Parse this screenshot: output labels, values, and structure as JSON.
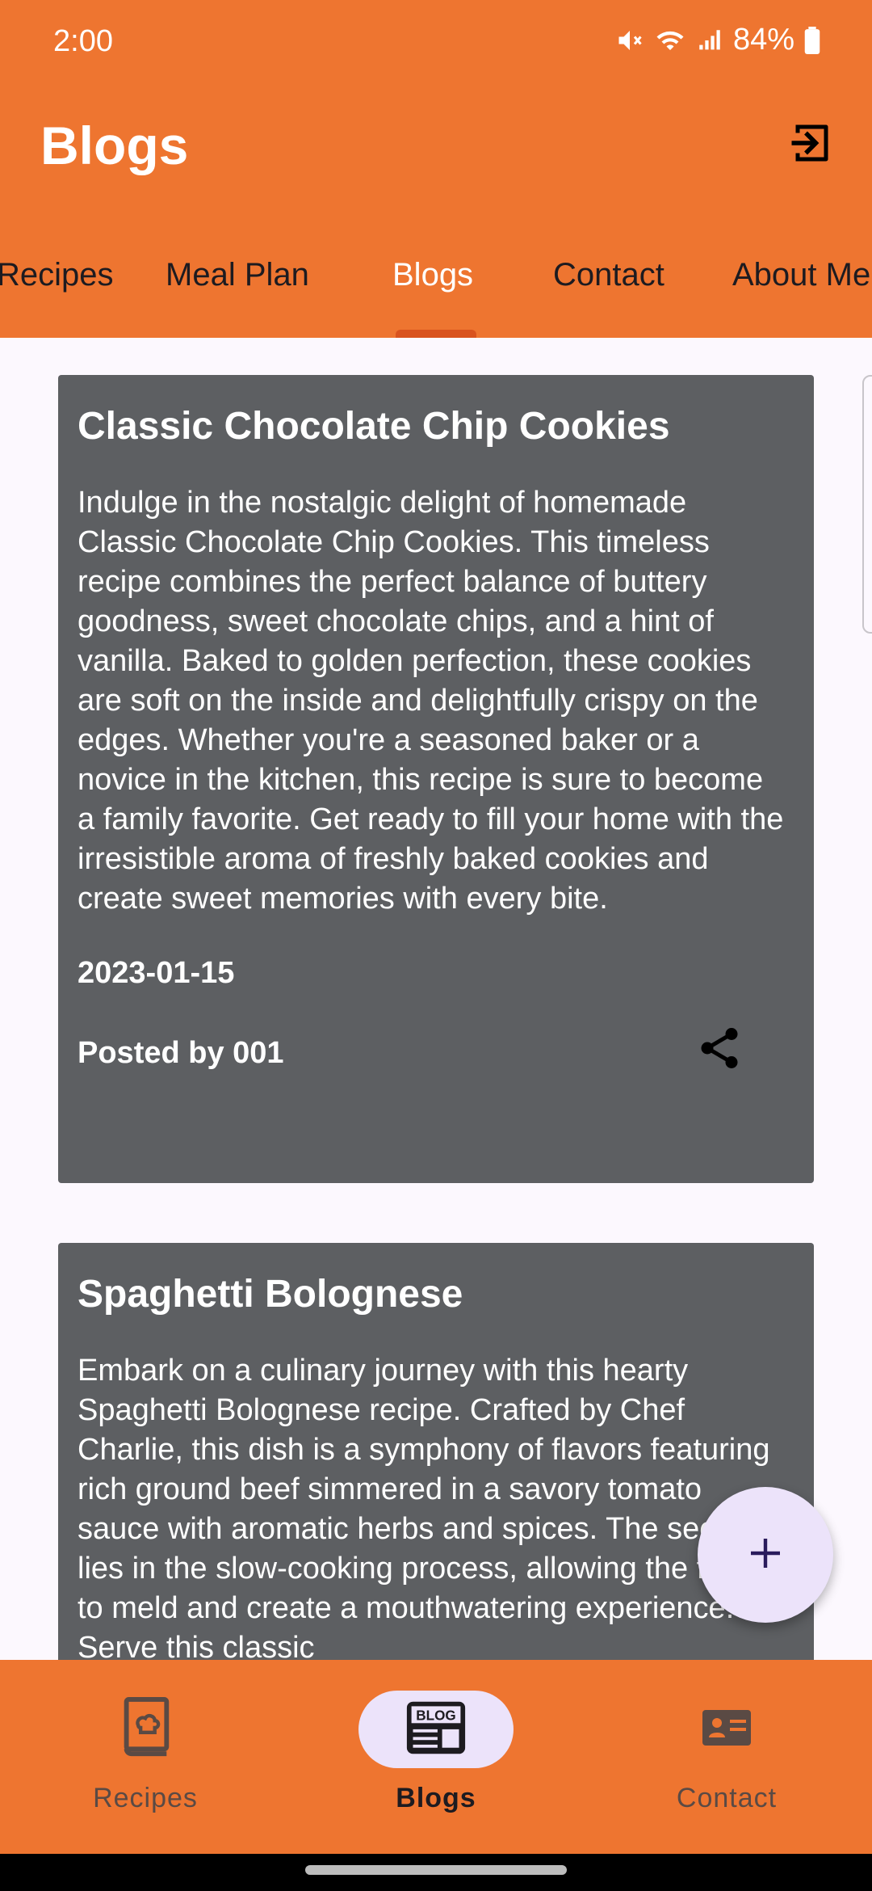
{
  "status_bar": {
    "time": "2:00",
    "battery": "84%",
    "icons": [
      "mute-icon",
      "wifi-icon",
      "signal-icon",
      "battery-icon"
    ]
  },
  "app_bar": {
    "title": "Blogs",
    "action_icon": "logout-icon"
  },
  "tabs": [
    {
      "label": "Recipes"
    },
    {
      "label": "Meal Plan"
    },
    {
      "label": "Blogs",
      "active": true
    },
    {
      "label": "Contact"
    },
    {
      "label": "About Me"
    }
  ],
  "posts": [
    {
      "title": "Classic Chocolate Chip Cookies",
      "body": "Indulge in the nostalgic delight of homemade Classic Chocolate Chip Cookies. This timeless recipe combines the perfect balance of buttery goodness, sweet chocolate chips, and a hint of vanilla. Baked to golden perfection, these cookies are soft on the inside and delightfully crispy on the edges. Whether you're a seasoned baker or a novice in the kitchen, this recipe is sure to become a family favorite. Get ready to fill your home with the irresistible aroma of freshly baked cookies and create sweet memories with every bite.",
      "date": "2023-01-15",
      "author": "Posted by 001"
    },
    {
      "title": "Spaghetti Bolognese",
      "body": "Embark on a culinary journey with this hearty Spaghetti Bolognese recipe. Crafted by Chef Charlie, this dish is a symphony of flavors featuring rich ground beef simmered in a savory tomato sauce with aromatic herbs and spices. The secret lies in the slow-cooking process, allowing the flavors to meld and create a mouthwatering experience. Serve this classic"
    }
  ],
  "fab": {
    "icon": "plus-icon"
  },
  "bottom_nav": [
    {
      "label": "Recipes",
      "icon": "recipe-book-icon"
    },
    {
      "label": "Blogs",
      "icon": "blog-icon",
      "active": true,
      "icon_text": "BLOG"
    },
    {
      "label": "Contact",
      "icon": "contact-card-icon"
    }
  ],
  "colors": {
    "primary": "#ee7530",
    "card": "#5d5f62",
    "pill": "#ece3fa",
    "background": "#fcf8fe"
  }
}
